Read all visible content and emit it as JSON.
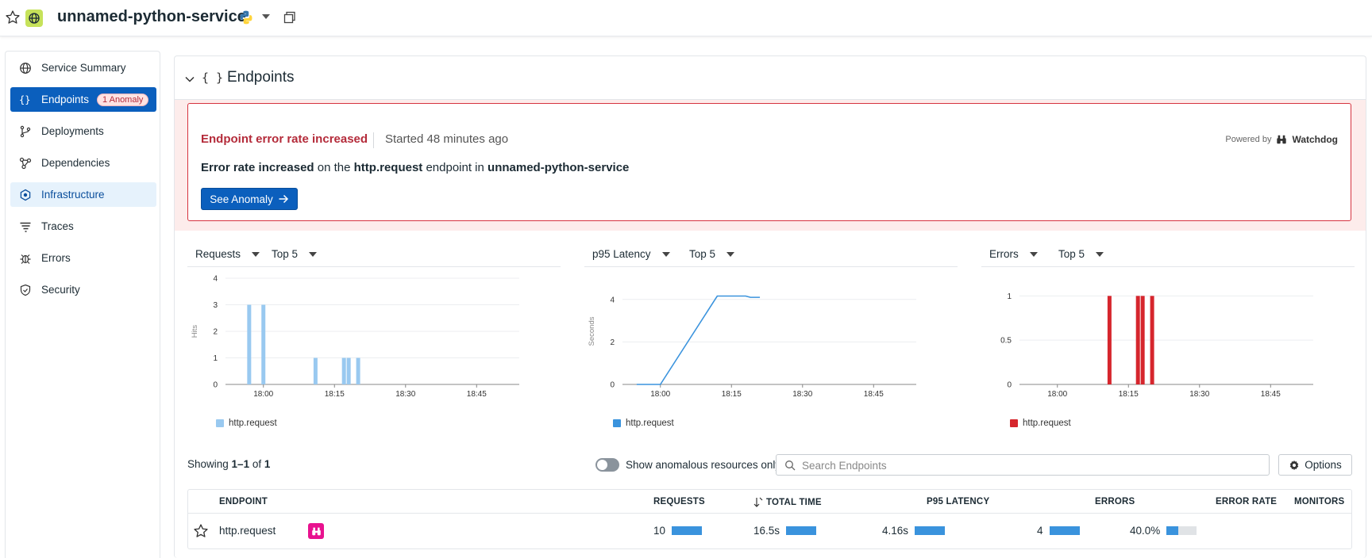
{
  "topbar": {
    "service_name": "unnamed-python-service"
  },
  "sidebar": {
    "items": [
      {
        "label": "Service Summary"
      },
      {
        "label": "Endpoints",
        "badge": "1 Anomaly"
      },
      {
        "label": "Deployments"
      },
      {
        "label": "Dependencies"
      },
      {
        "label": "Infrastructure"
      },
      {
        "label": "Traces"
      },
      {
        "label": "Errors"
      },
      {
        "label": "Security"
      }
    ]
  },
  "section": {
    "title": "Endpoints",
    "braces": "{ }"
  },
  "alert": {
    "title": "Endpoint error rate increased",
    "started": "Started 48 minutes ago",
    "powered_by": "Powered by",
    "powered_brand": "Watchdog",
    "body_1": "Error rate increased",
    "body_2": " on the ",
    "body_3": "http.request",
    "body_4": " endpoint in ",
    "body_5": "unnamed-python-service",
    "button": "See Anomaly"
  },
  "chart_data": [
    {
      "type": "bar",
      "metric": "Requests",
      "top": "Top 5",
      "ylabel": "Hits",
      "ylim": [
        0,
        4
      ],
      "yticks": [
        "0",
        "1",
        "2",
        "3",
        "4"
      ],
      "xticks": [
        "18:00",
        "18:15",
        "18:30",
        "18:45"
      ],
      "series": [
        {
          "name": "http.request",
          "color": "#99c9f0",
          "x": [
            "17:57",
            "18:00",
            "18:11",
            "18:17",
            "18:18",
            "18:20"
          ],
          "values": [
            3,
            3,
            1,
            1,
            1,
            1
          ]
        }
      ]
    },
    {
      "type": "line",
      "metric": "p95 Latency",
      "top": "Top 5",
      "ylabel": "Seconds",
      "ylim": [
        0,
        5
      ],
      "yticks": [
        "0",
        "2",
        "4"
      ],
      "xticks": [
        "18:00",
        "18:15",
        "18:30",
        "18:45"
      ],
      "series": [
        {
          "name": "http.request",
          "color": "#3a93dd",
          "x": [
            "17:55",
            "18:00",
            "18:12",
            "18:18",
            "18:19",
            "18:21"
          ],
          "values": [
            0,
            0,
            4.16,
            4.16,
            4.1,
            4.1
          ]
        }
      ]
    },
    {
      "type": "bar",
      "metric": "Errors",
      "top": "Top 5",
      "ylabel": "",
      "ylim": [
        0,
        1.2
      ],
      "yticks": [
        "0",
        "0.5",
        "1"
      ],
      "xticks": [
        "18:00",
        "18:15",
        "18:30",
        "18:45"
      ],
      "series": [
        {
          "name": "http.request",
          "color": "#d6262d",
          "x": [
            "18:11",
            "18:17",
            "18:18",
            "18:20"
          ],
          "values": [
            1,
            1,
            1,
            1
          ]
        }
      ]
    }
  ],
  "list": {
    "showing_prefix": "Showing ",
    "showing_range": "1–1",
    "showing_of": " of ",
    "showing_total": "1",
    "toggle_label": "Show anomalous resources only",
    "search_placeholder": "Search Endpoints",
    "options_label": "Options"
  },
  "table": {
    "columns": [
      "ENDPOINT",
      "REQUESTS",
      "TOTAL TIME",
      "P95 LATENCY",
      "ERRORS",
      "ERROR RATE",
      "MONITORS"
    ],
    "rows": [
      {
        "endpoint": "http.request",
        "requests": "10",
        "requests_fill": 1.0,
        "total_time": "16.5s",
        "total_time_fill": 1.0,
        "p95_latency": "4.16s",
        "p95_fill": 1.0,
        "errors": "4",
        "errors_fill": 1.0,
        "error_rate": "40.0%",
        "error_rate_fill": 0.4
      }
    ]
  },
  "colors": {
    "accent": "#0b5fbd",
    "alert": "#b42b3a",
    "anomaly_icon": "#e8128f"
  }
}
